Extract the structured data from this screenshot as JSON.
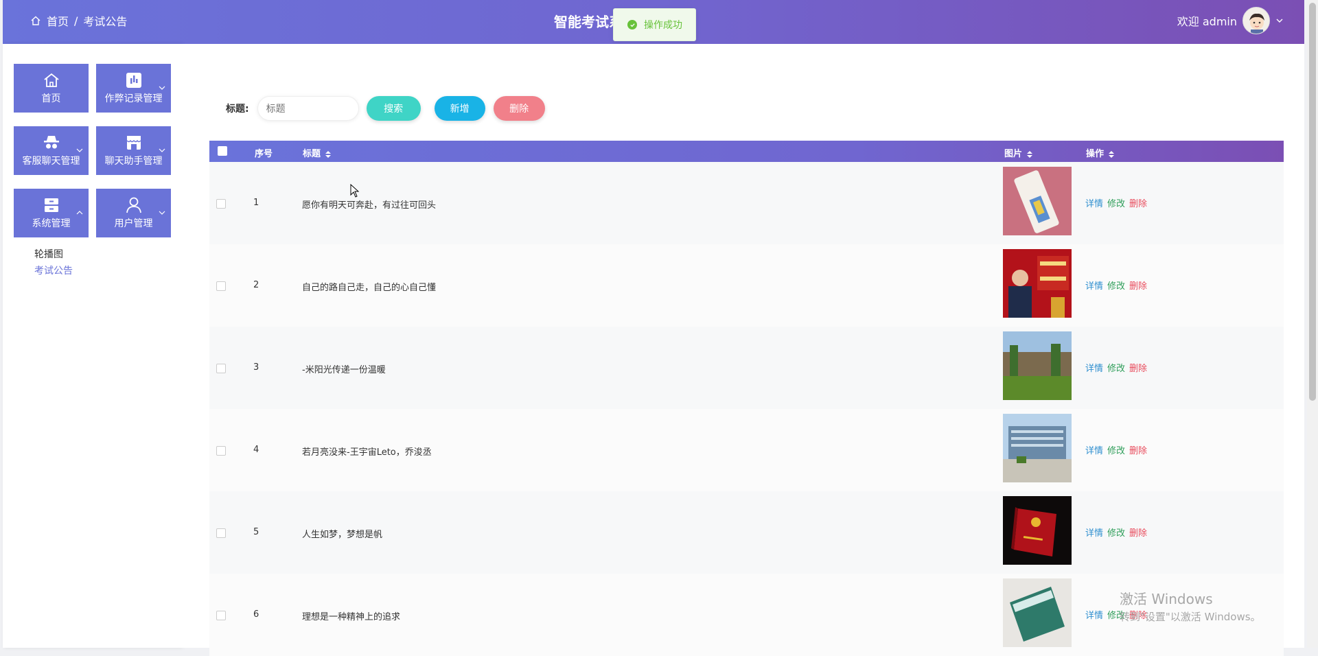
{
  "header": {
    "breadcrumb_home": "首页",
    "breadcrumb_sep": "/",
    "breadcrumb_current": "考试公告",
    "system_title": "智能考试系统",
    "welcome": "欢迎 admin"
  },
  "toast": {
    "message": "操作成功"
  },
  "sidebar": {
    "tiles": [
      {
        "label": "首页",
        "icon": "home-icon"
      },
      {
        "label": "作弊记录管理",
        "icon": "chart-icon"
      },
      {
        "label": "客服聊天管理",
        "icon": "incognito-icon"
      },
      {
        "label": "聊天助手管理",
        "icon": "store-icon"
      },
      {
        "label": "系统管理",
        "icon": "archive-icon"
      },
      {
        "label": "用户管理",
        "icon": "user-icon"
      }
    ],
    "submenu": [
      "轮播图",
      "考试公告"
    ]
  },
  "search": {
    "label": "标题:",
    "placeholder": "标题",
    "search_button": "搜索",
    "add_button": "新增",
    "delete_button": "删除"
  },
  "table": {
    "headers": {
      "index": "序号",
      "title": "标题",
      "image": "图片",
      "actions": "操作"
    },
    "rows": [
      {
        "index": "1",
        "title": "愿你有明天可奔赴，有过往可回头",
        "image": "thumb-pink-wrapped-item"
      },
      {
        "index": "2",
        "title": "自己的路自己走，自己的心自己懂",
        "image": "thumb-red-banner"
      },
      {
        "index": "3",
        "title": "-米阳光传递一份温暖",
        "image": "thumb-building-lawn"
      },
      {
        "index": "4",
        "title": "若月亮没来-王宇宙Leto，乔浚丞",
        "image": "thumb-campus-plaza"
      },
      {
        "index": "5",
        "title": "人生如梦，梦想是帆",
        "image": "thumb-red-book"
      },
      {
        "index": "6",
        "title": "理想是一种精神上的追求",
        "image": "thumb-green-card"
      }
    ],
    "action_labels": {
      "detail": "详情",
      "edit": "修改",
      "delete": "删除"
    }
  },
  "watermark": {
    "line1": "激活 Windows",
    "line2": "转到\"设置\"以激活 Windows。"
  }
}
